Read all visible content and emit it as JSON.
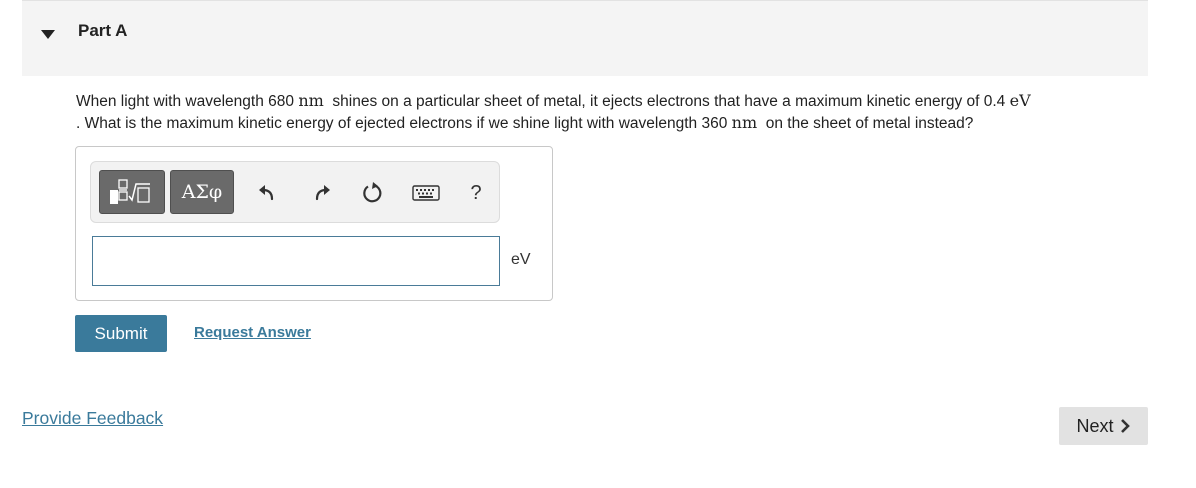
{
  "part": {
    "title": "Part A"
  },
  "question": {
    "line1_prefix": "When light with wavelength 680",
    "unit_nm": "nm",
    "line1_mid": "shines on a particular sheet of metal, it ejects electrons that have a maximum kinetic energy of 0.4",
    "unit_ev": "eV",
    "line2_prefix": ". What is the maximum kinetic energy of ejected electrons if we shine light with wavelength 360",
    "line2_suffix": "on the sheet of metal instead?"
  },
  "toolbar": {
    "greek_label": "ΑΣφ",
    "help_label": "?",
    "icons": [
      "templates-icon",
      "greek-letters-icon",
      "undo-icon",
      "redo-icon",
      "reset-icon",
      "keyboard-icon",
      "help-icon"
    ]
  },
  "answer": {
    "value": "",
    "unit": "eV"
  },
  "actions": {
    "submit_label": "Submit",
    "request_answer_label": "Request Answer"
  },
  "footer": {
    "feedback_label": "Provide Feedback",
    "next_label": "Next"
  },
  "colors": {
    "accent": "#3a7a9b",
    "header_bg": "#f4f4f4",
    "input_border": "#4a7b98"
  }
}
